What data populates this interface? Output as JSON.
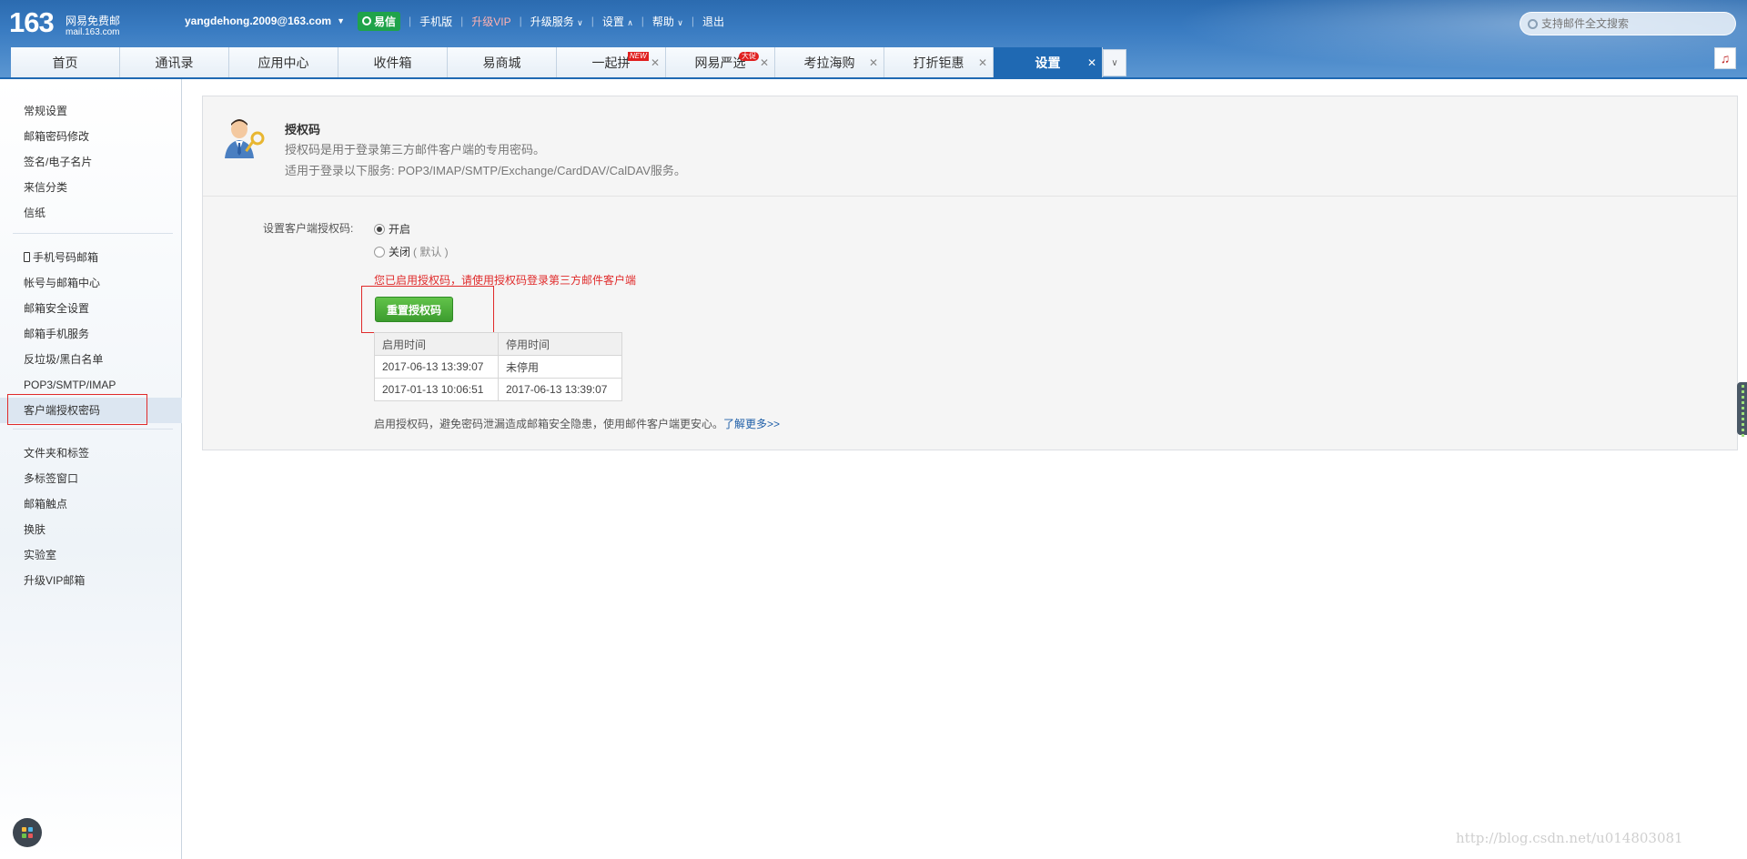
{
  "header": {
    "logo_num": "163",
    "logo_line1": "网易免费邮",
    "logo_line2": "mail.163.com",
    "account": "yangdehong.2009@163.com",
    "nav": {
      "yixin": "易信",
      "mobile": "手机版",
      "vip": "升级VIP",
      "upgrade": "升级服务",
      "settings": "设置",
      "help": "帮助",
      "logout": "退出"
    },
    "search_placeholder": "支持邮件全文搜索"
  },
  "tabs": [
    {
      "label": "首页"
    },
    {
      "label": "通讯录"
    },
    {
      "label": "应用中心"
    },
    {
      "label": "收件箱"
    },
    {
      "label": "易商城"
    },
    {
      "label": "一起拼",
      "badge": "NEW"
    },
    {
      "label": "网易严选",
      "badge": "大促"
    },
    {
      "label": "考拉海购"
    },
    {
      "label": "打折钜惠"
    },
    {
      "label": "设置"
    }
  ],
  "sidebar": {
    "group1": [
      "常规设置",
      "邮箱密码修改",
      "签名/电子名片",
      "来信分类",
      "信纸"
    ],
    "group2": [
      "手机号码邮箱",
      "帐号与邮箱中心",
      "邮箱安全设置",
      "邮箱手机服务",
      "反垃圾/黑白名单",
      "POP3/SMTP/IMAP",
      "客户端授权密码"
    ],
    "group3": [
      "文件夹和标签",
      "多标签窗口",
      "邮箱触点",
      "换肤",
      "实验室",
      "升级VIP邮箱"
    ]
  },
  "panel": {
    "title": "授权码",
    "desc1": "授权码是用于登录第三方邮件客户端的专用密码。",
    "desc2": "适用于登录以下服务: POP3/IMAP/SMTP/Exchange/CardDAV/CalDAV服务。",
    "form_label": "设置客户端授权码:",
    "radio_on": "开启",
    "radio_off": "关闭",
    "radio_off_note": "( 默认 )",
    "warning": "您已启用授权码，请使用授权码登录第三方邮件客户端",
    "reset_button": "重置授权码",
    "table": {
      "headers": [
        "启用时间",
        "停用时间"
      ],
      "rows": [
        [
          "2017-06-13 13:39:07",
          "未停用"
        ],
        [
          "2017-01-13 10:06:51",
          "2017-06-13 13:39:07"
        ]
      ]
    },
    "footnote": "启用授权码，避免密码泄漏造成邮箱安全隐患，使用邮件客户端更安心。",
    "learn_more": "了解更多>>"
  },
  "watermark": "http://blog.csdn.net/u014803081",
  "colors": {
    "header_blue": "#2b6bb0",
    "tab_active": "#1f69b3",
    "warning_red": "#e02a2a",
    "button_green": "#4caf3a"
  }
}
